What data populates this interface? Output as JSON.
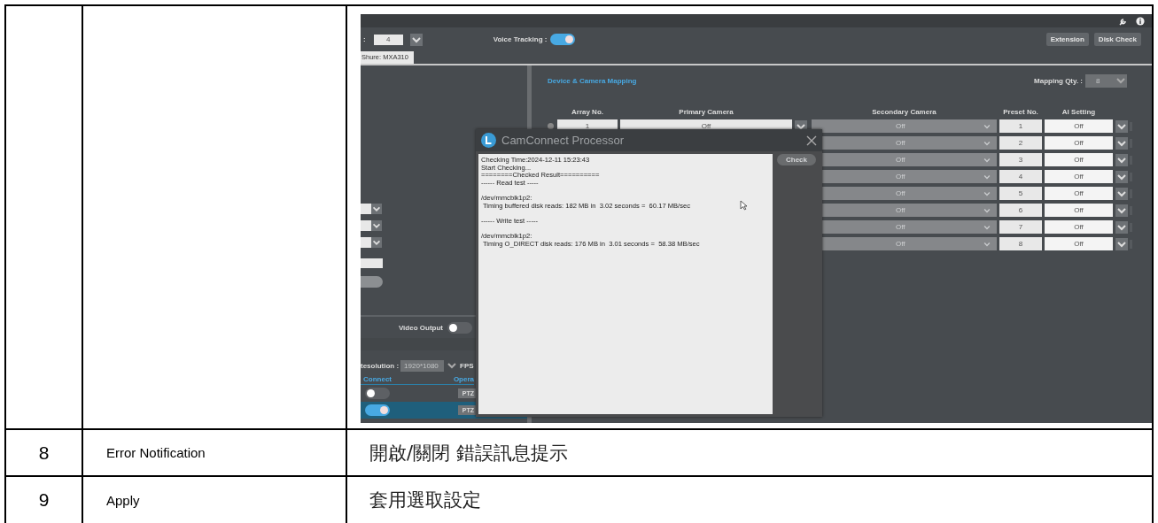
{
  "screenshot": {
    "toolbar": {
      "select_label": ":",
      "select_value": "4",
      "voice_tracking_label": "Voice Tracking :",
      "voice_tracking_on": true,
      "buttons": [
        "Extension",
        "Disk Check"
      ]
    },
    "tabs": [
      {
        "label": "Shure: MXA310",
        "selected": true
      }
    ],
    "left_panel": {
      "video_output_label": "Video Output",
      "video_output_on": false,
      "resolution_label": "tesolution :",
      "resolution_value": "1920*1080",
      "resolution_disabled": true,
      "fps_label": "FPS",
      "columns": [
        "Connect",
        "Opera"
      ],
      "devices": [
        {
          "connected": false,
          "operation": "PTZ",
          "selected": false
        },
        {
          "connected": true,
          "operation": "PTZ",
          "selected": true
        }
      ]
    },
    "mapping": {
      "title": "Device & Camera Mapping",
      "qty_label": "Mapping Qty. :",
      "qty_value": "8",
      "qty_disabled": true,
      "columns": [
        "Array No.",
        "Primary Camera",
        "Secondary Camera",
        "Preset No.",
        "AI Setting"
      ],
      "rows": [
        {
          "array_no": "1",
          "primary": "Off",
          "secondary": "Off",
          "secondary_disabled": true,
          "preset": "1",
          "ai": "Off"
        },
        {
          "secondary": "Off",
          "secondary_disabled": true,
          "preset": "2",
          "ai": "Off"
        },
        {
          "secondary": "Off",
          "secondary_disabled": true,
          "preset": "3",
          "ai": "Off"
        },
        {
          "secondary": "Off",
          "secondary_disabled": true,
          "preset": "4",
          "ai": "Off"
        },
        {
          "secondary": "Off",
          "secondary_disabled": true,
          "preset": "5",
          "ai": "Off"
        },
        {
          "secondary": "Off",
          "secondary_disabled": true,
          "preset": "6",
          "ai": "Off"
        },
        {
          "secondary": "Off",
          "secondary_disabled": true,
          "preset": "7",
          "ai": "Off"
        },
        {
          "secondary": "Off",
          "secondary_disabled": true,
          "preset": "8",
          "ai": "Off"
        }
      ]
    },
    "dialog": {
      "title": "CamConnect Processor",
      "log": [
        [
          "Checking Time:2024-12-11 15:23:43",
          "Start Checking...",
          "========Checked Result==========",
          "------ Read test -----"
        ],
        [
          "/dev/mmcblk1p2:",
          " Timing buffered disk reads: 182 MB in  3.02 seconds =  60.17 MB/sec"
        ],
        [
          "------ Write test -----"
        ],
        [
          "/dev/mmcblk1p2:",
          " Timing O_DIRECT disk reads: 176 MB in  3.01 seconds =  58.38 MB/sec"
        ]
      ],
      "check_button": {
        "label": "Check",
        "disabled": true
      }
    }
  },
  "rows": [
    {
      "number": "8",
      "name": "Error Notification",
      "description": "開啟/關閉  錯誤訊息提示"
    },
    {
      "number": "9",
      "name": "Apply",
      "description": "套用選取設定"
    }
  ]
}
